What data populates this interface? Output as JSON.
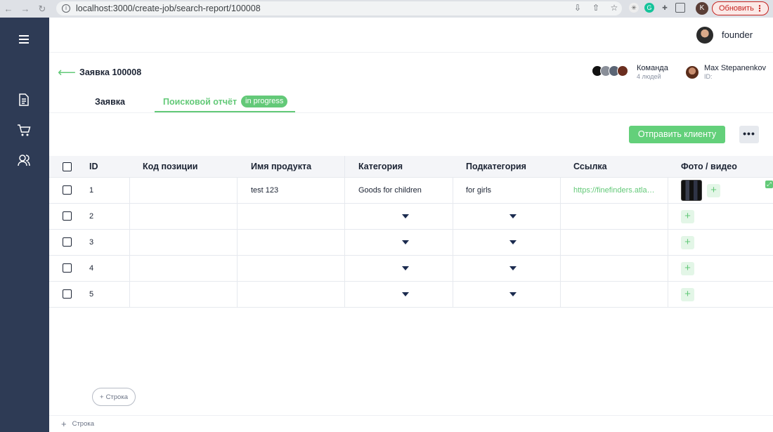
{
  "browser": {
    "url": "localhost:3000/create-job/search-report/100008",
    "profile_letter": "K",
    "update_label": "Обновить"
  },
  "sidebar": {
    "items": [
      {
        "icon": "menu-icon"
      },
      {
        "icon": "document-icon"
      },
      {
        "icon": "cart-icon"
      },
      {
        "icon": "users-icon"
      }
    ]
  },
  "header": {
    "user_name": "founder"
  },
  "page": {
    "title": "Заявка 100008",
    "team_label": "Команда",
    "team_count": "4 людей",
    "manager_name": "Max Stepanenkov",
    "manager_id": "ID:"
  },
  "tabs": [
    {
      "label": "Заявка"
    },
    {
      "label": "Поисковой отчёт",
      "badge": "in progress"
    }
  ],
  "actions": {
    "send_label": "Отправить клиенту",
    "more_label": "•••"
  },
  "table": {
    "columns": [
      "ID",
      "Код позиции",
      "Имя продукта",
      "Категория",
      "Подкатегория",
      "Ссылка",
      "Фото / видео"
    ],
    "rows": [
      {
        "id": "1",
        "code": "",
        "name": "test 123",
        "category": "Goods for children",
        "subcategory": "for girls",
        "link": "https://finefinders.atla…",
        "has_photo": true
      },
      {
        "id": "2",
        "code": "",
        "name": "",
        "category": "",
        "subcategory": "",
        "link": "",
        "has_photo": false
      },
      {
        "id": "3",
        "code": "",
        "name": "",
        "category": "",
        "subcategory": "",
        "link": "",
        "has_photo": false
      },
      {
        "id": "4",
        "code": "",
        "name": "",
        "category": "",
        "subcategory": "",
        "link": "",
        "has_photo": false
      },
      {
        "id": "5",
        "code": "",
        "name": "",
        "category": "",
        "subcategory": "",
        "link": "",
        "has_photo": false
      }
    ]
  },
  "add_row": {
    "pill_label": "Строка",
    "bottom_label": "Строка"
  },
  "colors": {
    "accent_green": "#63c978",
    "sidebar_bg": "#2e3b55"
  }
}
